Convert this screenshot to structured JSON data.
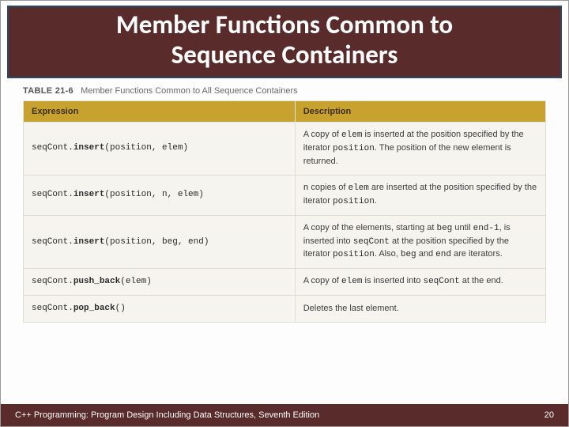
{
  "slide": {
    "title_line1": "Member Functions Common to",
    "title_line2": "Sequence Containers"
  },
  "table": {
    "caption_label": "TABLE 21-6",
    "caption_text": "Member Functions Common to All Sequence Containers",
    "headers": {
      "col1": "Expression",
      "col2": "Description"
    },
    "rows": [
      {
        "expr_prefix": "seqCont.",
        "expr_bold": "insert",
        "expr_args": "(position, elem)",
        "desc_html": "A copy of <span class='code'>elem</span> is inserted at the position specified by the iterator <span class='code'>position</span>. The position of the new element is returned."
      },
      {
        "expr_prefix": "seqCont.",
        "expr_bold": "insert",
        "expr_args": "(position, n, elem)",
        "desc_html": "<span class='code'>n</span> copies of <span class='code'>elem</span> are inserted at the position specified by the iterator <span class='code'>position</span>."
      },
      {
        "expr_prefix": "seqCont.",
        "expr_bold": "insert",
        "expr_args": "(position, beg, end)",
        "desc_html": "A copy of the elements, starting at <span class='code'>beg</span> until <span class='code'>end-1</span>, is inserted into <span class='code'>seqCont</span> at the position specified by the iterator <span class='code'>position</span>. Also, <span class='code'>beg</span> and <span class='code'>end</span> are iterators."
      },
      {
        "expr_prefix": "seqCont.",
        "expr_bold": "push_back",
        "expr_args": "(elem)",
        "desc_html": "A copy of <span class='code'>elem</span> is inserted into <span class='code'>seqCont</span> at the end."
      },
      {
        "expr_prefix": "seqCont.",
        "expr_bold": "pop_back",
        "expr_args": "()",
        "desc_html": "Deletes the last element."
      }
    ]
  },
  "footer": {
    "text": "C++ Programming: Program Design Including Data Structures, Seventh Edition",
    "page": "20"
  }
}
